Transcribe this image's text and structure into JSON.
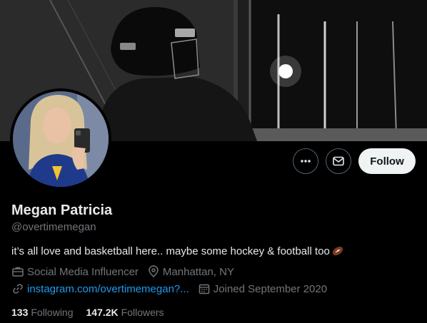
{
  "profile": {
    "name": "Megan Patricia",
    "handle": "@overtimemegan",
    "bio": "it’s all love and basketball here.. maybe some hockey & football too",
    "bio_emoji": "football-emoji",
    "category": "Social Media Influencer",
    "location": "Manhattan, NY",
    "website": "instagram.com/overtimemegan?...",
    "joined": "Joined September 2020"
  },
  "stats": {
    "following_count": "133",
    "following_label": "Following",
    "followers_count": "147.2K",
    "followers_label": "Followers"
  },
  "actions": {
    "more_icon": "more-horizontal-icon",
    "message_icon": "envelope-icon",
    "follow_label": "Follow"
  },
  "icons": {
    "category": "briefcase-icon",
    "location": "location-pin-icon",
    "website": "link-icon",
    "joined": "calendar-icon"
  },
  "colors": {
    "background": "#000000",
    "primary_text": "#e7e9ea",
    "secondary_text": "#71767b",
    "link": "#1d9bf0",
    "follow_button_bg": "#eff3f4",
    "follow_button_text": "#0f1419",
    "button_border": "#536471"
  }
}
